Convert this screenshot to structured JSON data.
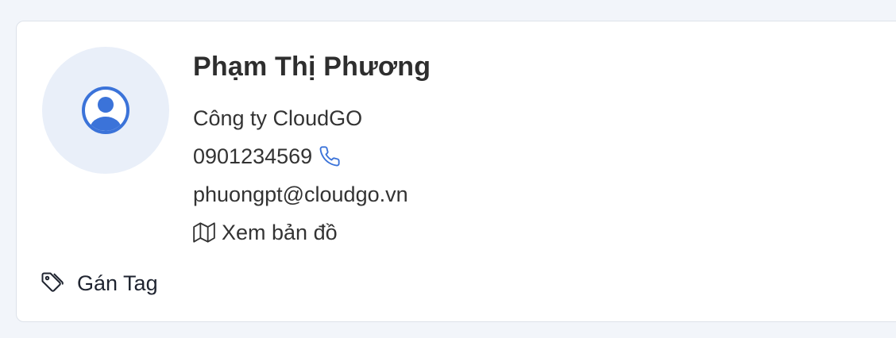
{
  "contact": {
    "name": "Phạm Thị Phương",
    "company": "Công ty CloudGO",
    "phone": "0901234569",
    "email": "phuongpt@cloudgo.vn",
    "map_label": "Xem bản đồ"
  },
  "actions": {
    "tag_label": "Gán Tag"
  },
  "icons": {
    "avatar": "user-circle-icon",
    "phone": "phone-icon",
    "map": "map-icon",
    "tag": "tag-icon"
  },
  "colors": {
    "accent": "#3b73d9",
    "avatar_bg": "#e9eff9",
    "text": "#333333"
  }
}
